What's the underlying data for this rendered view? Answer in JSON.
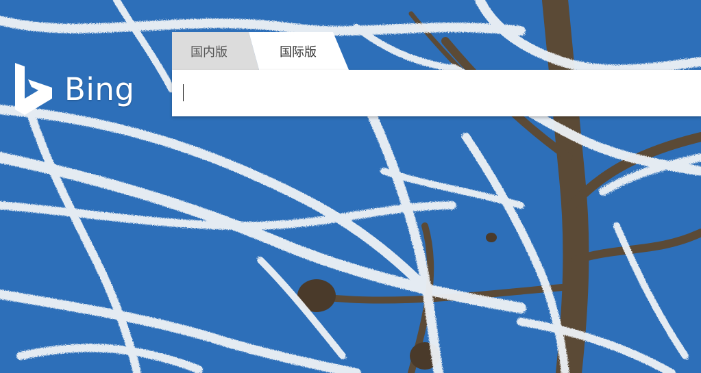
{
  "brand": {
    "name": "Bing",
    "logo_icon": "bing-logo-icon",
    "text_color": "#ffffff"
  },
  "tabs": [
    {
      "label": "国内版",
      "active": false
    },
    {
      "label": "国际版",
      "active": true
    }
  ],
  "search": {
    "value": "",
    "placeholder": ""
  },
  "background": {
    "sky_color": "#2c6fb8",
    "frost_color": "#eef2f6",
    "branch_color": "#5a4a35"
  }
}
